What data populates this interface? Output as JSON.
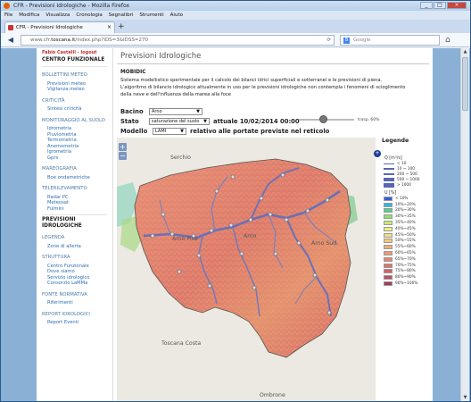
{
  "window": {
    "title": "CFR - Previsioni Idrologiche - Mozilla Firefox"
  },
  "menu": [
    "File",
    "Modifica",
    "Visualizza",
    "Cronologia",
    "Segnalibri",
    "Strumenti",
    "Aiuto"
  ],
  "tab": {
    "label": "CFR - Previsioni Idrologiche",
    "close": "×",
    "new": "+"
  },
  "nav": {
    "back": "◀",
    "url_prefix": "www.cfr.",
    "url_host": "toscana.it",
    "url_rest": "/index.php?IDS=3&IDSS=270",
    "reload": "⟳",
    "search_placeholder": "Google",
    "search_engine_glyph": "8",
    "home": "⌂"
  },
  "sidebar": {
    "user": "Fabio Castelli - logout",
    "main_title": "CENTRO FUNZIONALE",
    "sections": [
      {
        "title": "BOLLETTINI METEO",
        "links": [
          "Previsioni meteo",
          "Vigilanza meteo"
        ]
      },
      {
        "title": "CRITICITÀ",
        "links": [
          "Sintesi criticità"
        ]
      },
      {
        "title": "MONITORAGGIO AL SUOLO",
        "links": [
          "Idrometria",
          "Pluviometria",
          "Termometria",
          "Anemometria",
          "Igrometria",
          "Gprs"
        ]
      },
      {
        "title": "MAREOGRAFIA",
        "links": [
          "Boe ondametriche"
        ]
      },
      {
        "title": "TELERILEVAMENTO",
        "links": [
          "Radar PC",
          "Meteosat",
          "Fulmini"
        ]
      }
    ],
    "active_title": "PREVISIONI IDROLOGICHE",
    "sections2": [
      {
        "title": "LEGENDA",
        "links": [
          "Zone di allerta"
        ]
      },
      {
        "title": "STRUTTURA",
        "links": [
          "Centro Funzionale",
          "Dove siamo",
          "Servizio idrologico",
          "Consorzio LaMMa"
        ]
      },
      {
        "title": "FONTE NORMATIVA",
        "links": [
          "Riferimenti"
        ]
      },
      {
        "title": "REPORT IDROLOGICI",
        "links": [
          "Report Eventi"
        ]
      }
    ]
  },
  "content": {
    "heading": "Previsioni Idrologiche",
    "model_name": "MOBIDIC",
    "desc1": "Sistema modellistico sperimentale per il calcolo dei bilanci idrici superficiali e sotterranei e le previsioni di piena.",
    "desc2": "L'algoritmo di bilancio idrologico attualmente in uso per le previsioni idrologiche non contempla i fenomeni di scioglimento della neve e dell'influenza della marea alla foce",
    "bacino_label": "Bacino",
    "bacino_value": "Arno",
    "stato_label": "Stato",
    "stato_value": "saturazione del suolo",
    "stato_time": "attuale 10/02/2014 00:00",
    "trasp_label": "trasp. 60%",
    "trasparenza": 0.6,
    "modello_label": "Modello",
    "modello_value": "LAMI",
    "modello_text": "relativo alle portate previste nel reticolo"
  },
  "map": {
    "zoom_in": "+",
    "zoom_out": "−",
    "labels": [
      "Serchio",
      "Arno Pisa",
      "Arno",
      "Arno Sud",
      "Toscana Costa",
      "Ombrone"
    ]
  },
  "legend": {
    "title": "Legende",
    "plus": "+",
    "q_title": "Q [m³/s]",
    "q_items": [
      "< 10",
      "10 ~ 100",
      "200 ~ 500",
      "500 ~ 1000",
      "> 1000"
    ],
    "u_title": "U [%]",
    "u_items": [
      "< 10%",
      "10%~20%",
      "20%~30%",
      "30%~35%",
      "35%~40%",
      "40%~45%",
      "45%~50%",
      "50%~55%",
      "55%~60%",
      "60%~65%",
      "65%~70%",
      "70%~75%",
      "75%~80%",
      "80%~90%",
      "90%~100%"
    ],
    "u_colors": [
      "#2b5fd6",
      "#35b7d6",
      "#4fd08f",
      "#8fe070",
      "#c6ec6a",
      "#eef07a",
      "#f6dc7e",
      "#f2c77c",
      "#f1ad77",
      "#ec9a74",
      "#e6856f",
      "#de716b",
      "#d45f66",
      "#c34d5f",
      "#a63c55"
    ]
  }
}
